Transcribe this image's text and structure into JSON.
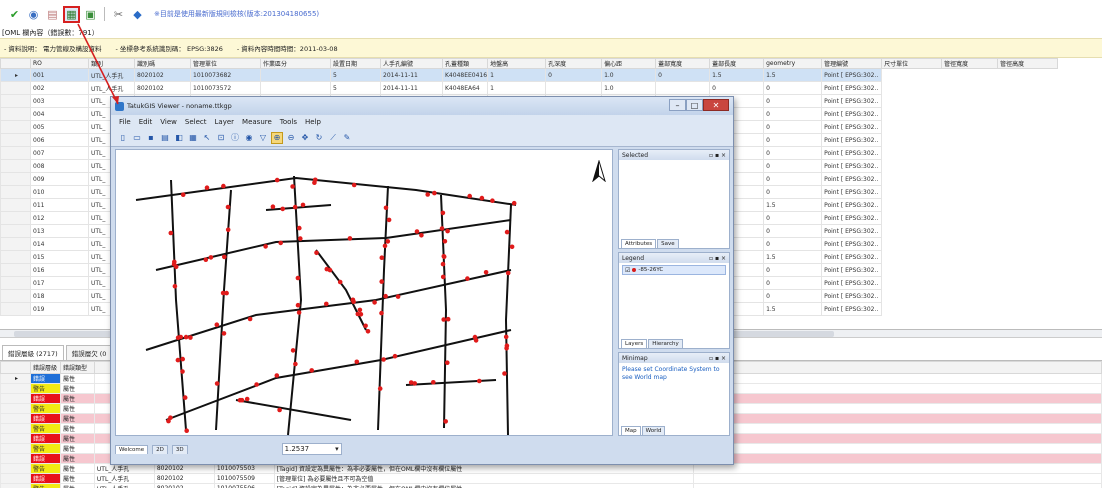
{
  "toolbar": {
    "note": "※目前是使用最新版規則檢核(版本:201304180655)"
  },
  "subheader": "[OML 欄內容（錯誤數：791）",
  "infobar": {
    "item1": "- 資料說明： 電力管線及構設資料",
    "item2": "- 坐標參考系統識別碼： EPSG:3826",
    "item3": "- 資料內容時間時間：2011-03-08"
  },
  "grid": {
    "columns": [
      "RO",
      "類別",
      "識別碼",
      "管理單位",
      "作業區分",
      "設置日期",
      "人手孔編號",
      "孔蓋種類",
      "地盤高",
      "孔深度",
      "偏心距",
      "蓋部寬度",
      "蓋部長度",
      "geometry",
      "管理編號",
      "尺寸單位",
      "管徑寬度",
      "管徑高度"
    ],
    "rows": [
      [
        "001",
        "UTL_人手孔",
        "8020102",
        "1010073682",
        "",
        "5",
        "2014-11-11",
        "K4048EE0416",
        "1",
        "0",
        "1.0",
        "0",
        "1.5",
        "1.5",
        "Point [ EPSG:302.."
      ],
      [
        "002",
        "UTL_人手孔",
        "8020102",
        "1010073572",
        "",
        "5",
        "2014-11-11",
        "K4048EA64",
        "1",
        "",
        "1.0",
        "",
        "0",
        "0",
        "Point [ EPSG:302.."
      ],
      [
        "003",
        "UTL_",
        "",
        "",
        "",
        "",
        "",
        "",
        "",
        "",
        "",
        "",
        "0",
        "0",
        "Point [ EPSG:302.."
      ],
      [
        "004",
        "UTL_",
        "",
        "",
        "",
        "",
        "",
        "",
        "",
        "",
        "",
        "",
        "0",
        "0",
        "Point [ EPSG:302.."
      ],
      [
        "005",
        "UTL_",
        "",
        "",
        "",
        "",
        "",
        "",
        "",
        "",
        "",
        "",
        "0",
        "0",
        "Point [ EPSG:302.."
      ],
      [
        "006",
        "UTL_",
        "",
        "",
        "",
        "",
        "",
        "",
        "",
        "",
        "",
        "",
        "0",
        "0",
        "Point [ EPSG:302.."
      ],
      [
        "007",
        "UTL_",
        "",
        "",
        "",
        "",
        "",
        "",
        "",
        "",
        "",
        "",
        "0",
        "0",
        "Point [ EPSG:302.."
      ],
      [
        "008",
        "UTL_",
        "",
        "",
        "",
        "",
        "",
        "",
        "",
        "",
        "",
        "",
        "0",
        "0",
        "Point [ EPSG:302.."
      ],
      [
        "009",
        "UTL_",
        "",
        "",
        "",
        "",
        "",
        "",
        "",
        "",
        "",
        "",
        "0",
        "0",
        "Point [ EPSG:302.."
      ],
      [
        "010",
        "UTL_",
        "",
        "",
        "",
        "",
        "",
        "",
        "",
        "",
        "",
        "",
        "0",
        "0",
        "Point [ EPSG:302.."
      ],
      [
        "011",
        "UTL_",
        "",
        "",
        "",
        "",
        "",
        "",
        "",
        "",
        "",
        "",
        "1.5",
        "1.5",
        "Point [ EPSG:302.."
      ],
      [
        "012",
        "UTL_",
        "",
        "",
        "",
        "",
        "",
        "",
        "",
        "",
        "",
        "",
        "0",
        "0",
        "Point [ EPSG:302.."
      ],
      [
        "013",
        "UTL_",
        "",
        "",
        "",
        "",
        "",
        "",
        "",
        "",
        "",
        "",
        "0",
        "0",
        "Point [ EPSG:302.."
      ],
      [
        "014",
        "UTL_",
        "",
        "",
        "",
        "",
        "",
        "",
        "",
        "",
        "",
        "",
        "0",
        "0",
        "Point [ EPSG:302.."
      ],
      [
        "015",
        "UTL_",
        "",
        "",
        "",
        "",
        "",
        "",
        "",
        "",
        "",
        "",
        "1.5",
        "1.5",
        "Point [ EPSG:302.."
      ],
      [
        "016",
        "UTL_",
        "",
        "",
        "",
        "",
        "",
        "",
        "",
        "",
        "",
        "",
        "0",
        "0",
        "Point [ EPSG:302.."
      ],
      [
        "017",
        "UTL_",
        "",
        "",
        "",
        "",
        "",
        "",
        "",
        "",
        "",
        "",
        "0",
        "0",
        "Point [ EPSG:302.."
      ],
      [
        "018",
        "UTL_",
        "",
        "",
        "",
        "",
        "",
        "",
        "",
        "",
        "",
        "",
        "0",
        "0",
        "Point [ EPSG:302.."
      ],
      [
        "019",
        "UTL_",
        "",
        "",
        "",
        "",
        "",
        "",
        "",
        "",
        "",
        "",
        "1.5",
        "1.5",
        "Point [ EPSG:302.."
      ]
    ]
  },
  "bottom_tabs": [
    "錯誤層級 (2717)",
    "錯誤層欠 (0"
  ],
  "bottom_grid": {
    "columns": [
      "錯誤層級",
      "錯誤類型"
    ],
    "rows": [
      {
        "level": "錯誤",
        "type": "屬性",
        "lv": "blu",
        "pink": false,
        "extra": [
          "",
          "",
          "",
          "",
          ""
        ]
      },
      {
        "level": "警告",
        "type": "屬性",
        "lv": "yel",
        "pink": false,
        "extra": [
          "",
          "",
          "",
          "",
          ""
        ]
      },
      {
        "level": "錯誤",
        "type": "屬性",
        "lv": "red",
        "pink": true,
        "extra": [
          "",
          "",
          "",
          "",
          ""
        ]
      },
      {
        "level": "警告",
        "type": "屬性",
        "lv": "yel",
        "pink": false,
        "extra": [
          "",
          "",
          "",
          "",
          ""
        ]
      },
      {
        "level": "錯誤",
        "type": "屬性",
        "lv": "red",
        "pink": true,
        "extra": [
          "",
          "",
          "",
          "",
          ""
        ]
      },
      {
        "level": "警告",
        "type": "屬性",
        "lv": "yel",
        "pink": false,
        "extra": [
          "",
          "",
          "",
          "",
          ""
        ]
      },
      {
        "level": "錯誤",
        "type": "屬性",
        "lv": "red",
        "pink": true,
        "extra": [
          "",
          "",
          "",
          "",
          ""
        ]
      },
      {
        "level": "警告",
        "type": "屬性",
        "lv": "yel",
        "pink": false,
        "extra": [
          "",
          "",
          "",
          "",
          ""
        ]
      },
      {
        "level": "錯誤",
        "type": "屬性",
        "lv": "red",
        "pink": true,
        "extra": [
          "",
          "",
          "",
          "",
          ""
        ]
      },
      {
        "level": "警告",
        "type": "屬性",
        "lv": "yel",
        "pink": false,
        "extra": [
          "UTL_人手孔",
          "8020102",
          "1010075503",
          "[Tagid] 資設定為異屬性：為非必要屬性，但在OML欄中沒有欄位屬性",
          ""
        ]
      },
      {
        "level": "錯誤",
        "type": "屬性",
        "lv": "red",
        "pink": false,
        "extra": [
          "UTL_人手孔",
          "8020102",
          "1010075509",
          "[管理單位] 為必要屬性且不可為空值",
          ""
        ]
      },
      {
        "level": "警告",
        "type": "屬性",
        "lv": "yel",
        "pink": false,
        "extra": [
          "UTL_人手孔",
          "8020102",
          "1010075506",
          "[Tagid] 資設定為異屬性：為非必要屬性，但在OML欄中沒有欄位屬性",
          ""
        ]
      }
    ]
  },
  "viewer": {
    "title": "TatukGIS Viewer - noname.ttkgp",
    "menu": [
      "File",
      "Edit",
      "View",
      "Select",
      "Layer",
      "Measure",
      "Tools",
      "Help"
    ],
    "selected_title": "Selected",
    "legend_title": "Legend",
    "legend_item": "-85-26YC",
    "minimap_title": "Minimap",
    "minimap_note": "Please set Coordinate System to see World map",
    "sel_tabs": [
      "Attributes",
      "Save"
    ],
    "leg_tabs": [
      "Layers",
      "Hierarchy"
    ],
    "mini_tabs": [
      "Map",
      "World"
    ],
    "status_tabs": [
      "Welcome",
      "2D",
      "3D"
    ],
    "scale": "1.2537"
  }
}
